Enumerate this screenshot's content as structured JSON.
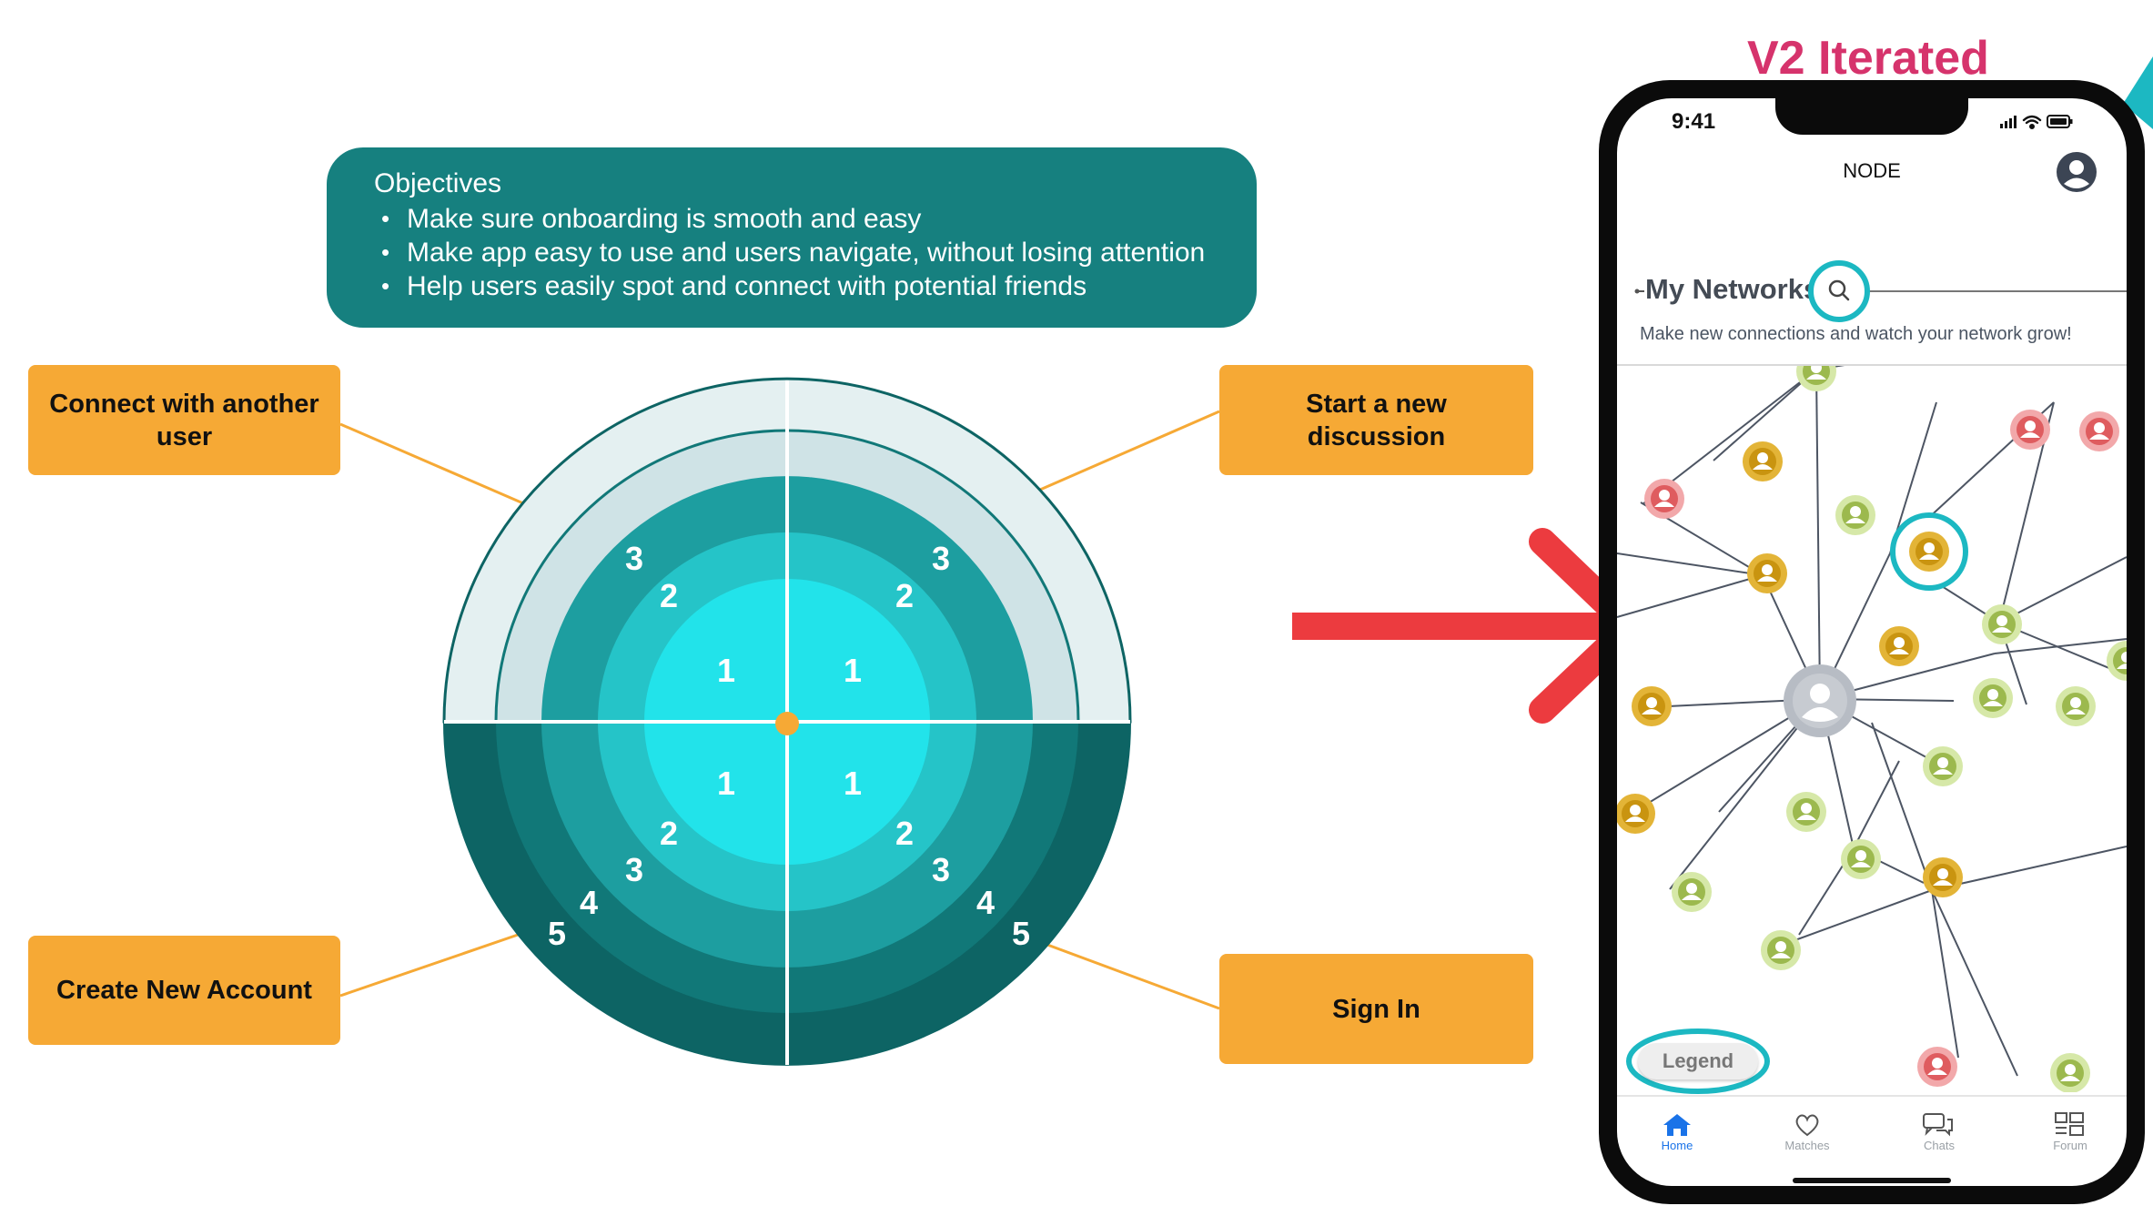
{
  "objectives": {
    "title": "Objectives",
    "items": [
      "Make sure onboarding is smooth and easy",
      "Make app easy to use and users navigate, without losing attention",
      "Help users easily spot and connect with potential friends"
    ]
  },
  "tags": {
    "connect": "Connect with another user",
    "discussion": "Start a new discussion",
    "create": "Create New Account",
    "signin": "Sign In"
  },
  "bullseye": {
    "upper_left": [
      "3",
      "2",
      "1"
    ],
    "upper_right": [
      "3",
      "2",
      "1"
    ],
    "lower_left": [
      "1",
      "2",
      "3",
      "4",
      "5"
    ],
    "lower_right": [
      "1",
      "2",
      "3",
      "4",
      "5"
    ]
  },
  "version_label": "V2 Iterated",
  "phone": {
    "status_time": "9:41",
    "app_title": "NODE",
    "section_title": "My Networks",
    "section_subtitle": "Make new connections and watch your network grow!",
    "legend_label": "Legend",
    "tabs": [
      {
        "label": "Home",
        "icon": "home-icon"
      },
      {
        "label": "Matches",
        "icon": "heart-icon"
      },
      {
        "label": "Chats",
        "icon": "chat-icon"
      },
      {
        "label": "Forum",
        "icon": "forum-icon"
      }
    ]
  },
  "colors": {
    "teal": "#16807f",
    "orange": "#f6a935",
    "arrow_red": "#ec3b3f",
    "highlight": "#1cb8c2",
    "node_green": "#a7c25f",
    "node_gold": "#d9a010",
    "node_red": "#e0686a",
    "accent": "#d6336c"
  }
}
